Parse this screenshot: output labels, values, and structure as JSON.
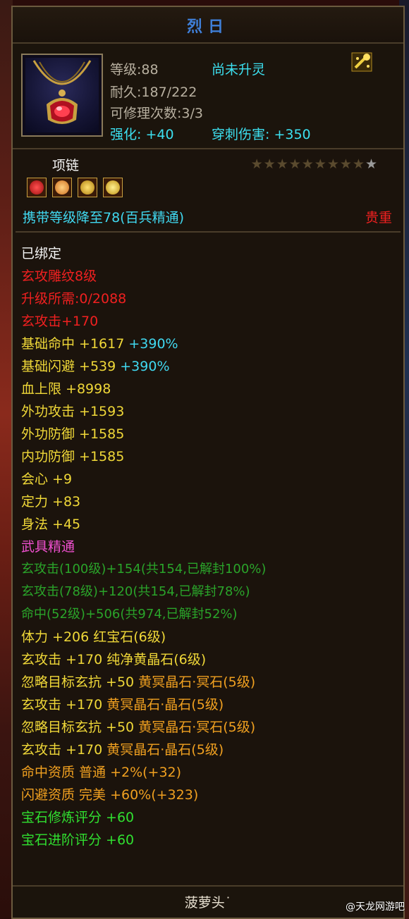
{
  "item": {
    "title": "烈日",
    "level": "等级:88",
    "awaken": "尚未升灵",
    "durability": "耐久:187/222",
    "repairs": "可修理次数:3/3",
    "enhance": "强化: +40",
    "pierce": "穿刺伤害: +350",
    "type": "项链",
    "stars_filled": 9,
    "stars_total": 10,
    "carry_level": "携带等级降至78(百兵精通)",
    "value_tag": "贵重",
    "icon_name": "red-pendant-icon"
  },
  "gems": [
    {
      "name": "red-gem-icon",
      "color": "#d02020"
    },
    {
      "name": "yellow-crystal-icon",
      "color": "#e89030"
    },
    {
      "name": "yellow-coin-icon",
      "color": "#e0b020"
    },
    {
      "name": "gold-coin-icon",
      "color": "#f0c020"
    }
  ],
  "attributes": [
    {
      "parts": [
        {
          "text": "已绑定",
          "cls": "white"
        }
      ]
    },
    {
      "parts": [
        {
          "text": "玄攻雕纹8级",
          "cls": "red"
        }
      ]
    },
    {
      "parts": [
        {
          "text": "升级所需:0/2088",
          "cls": "red"
        }
      ]
    },
    {
      "parts": [
        {
          "text": "玄攻击+170",
          "cls": "red"
        }
      ]
    },
    {
      "parts": [
        {
          "text": "基础命中 +1617 ",
          "cls": "yellow"
        },
        {
          "text": "+390%",
          "cls": "lblue"
        }
      ]
    },
    {
      "parts": [
        {
          "text": "基础闪避 +539 ",
          "cls": "yellow"
        },
        {
          "text": "+390%",
          "cls": "lblue"
        }
      ]
    },
    {
      "parts": [
        {
          "text": "血上限 +8998",
          "cls": "yellow"
        }
      ]
    },
    {
      "parts": [
        {
          "text": "外功攻击 +1593",
          "cls": "yellow"
        }
      ]
    },
    {
      "parts": [
        {
          "text": "外功防御 +1585",
          "cls": "yellow"
        }
      ]
    },
    {
      "parts": [
        {
          "text": "内功防御 +1585",
          "cls": "yellow"
        }
      ]
    },
    {
      "parts": [
        {
          "text": "会心 +9",
          "cls": "yellow"
        }
      ]
    },
    {
      "parts": [
        {
          "text": "定力 +83",
          "cls": "yellow"
        }
      ]
    },
    {
      "parts": [
        {
          "text": "身法 +45",
          "cls": "yellow"
        }
      ]
    },
    {
      "parts": [
        {
          "text": "武具精通",
          "cls": "pink"
        }
      ]
    },
    {
      "small": true,
      "parts": [
        {
          "text": "玄攻击(100级)+154(共154,已解封100%)",
          "cls": "green"
        }
      ]
    },
    {
      "small": true,
      "parts": [
        {
          "text": "玄攻击(78级)+120(共154,已解封78%)",
          "cls": "green"
        }
      ]
    },
    {
      "small": true,
      "parts": [
        {
          "text": "命中(52级)+506(共974,已解封52%)",
          "cls": "green"
        }
      ]
    },
    {
      "parts": [
        {
          "text": "体力 +206 红宝石(6级)",
          "cls": "yellow"
        }
      ]
    },
    {
      "parts": [
        {
          "text": "玄攻击 +170 纯净黄晶石(6级)",
          "cls": "yellow"
        }
      ]
    },
    {
      "parts": [
        {
          "text": "忽略目标玄抗 +50 ",
          "cls": "yellow"
        },
        {
          "text": "黄冥晶石·冥石(5级)",
          "cls": "orange"
        }
      ]
    },
    {
      "parts": [
        {
          "text": "玄攻击 +170 ",
          "cls": "yellow"
        },
        {
          "text": "黄冥晶石·晶石(5级)",
          "cls": "orange"
        }
      ]
    },
    {
      "parts": [
        {
          "text": "忽略目标玄抗 +50 ",
          "cls": "yellow"
        },
        {
          "text": "黄冥晶石·冥石(5级)",
          "cls": "orange"
        }
      ]
    },
    {
      "parts": [
        {
          "text": "玄攻击 +170 ",
          "cls": "yellow"
        },
        {
          "text": "黄冥晶石·晶石(5级)",
          "cls": "orange"
        }
      ]
    },
    {
      "parts": [
        {
          "text": "命中资质 普通 +2%(+32)",
          "cls": "orange"
        }
      ]
    },
    {
      "parts": [
        {
          "text": "闪避资质 完美 +60%(+323)",
          "cls": "orange"
        }
      ]
    },
    {
      "parts": [
        {
          "text": "宝石修炼评分 +60",
          "cls": "bright-green"
        }
      ]
    },
    {
      "parts": [
        {
          "text": "宝石进阶评分 +60",
          "cls": "bright-green"
        }
      ]
    }
  ],
  "footer": {
    "name": "菠萝头˙",
    "watermark": "@天龙网游吧"
  }
}
